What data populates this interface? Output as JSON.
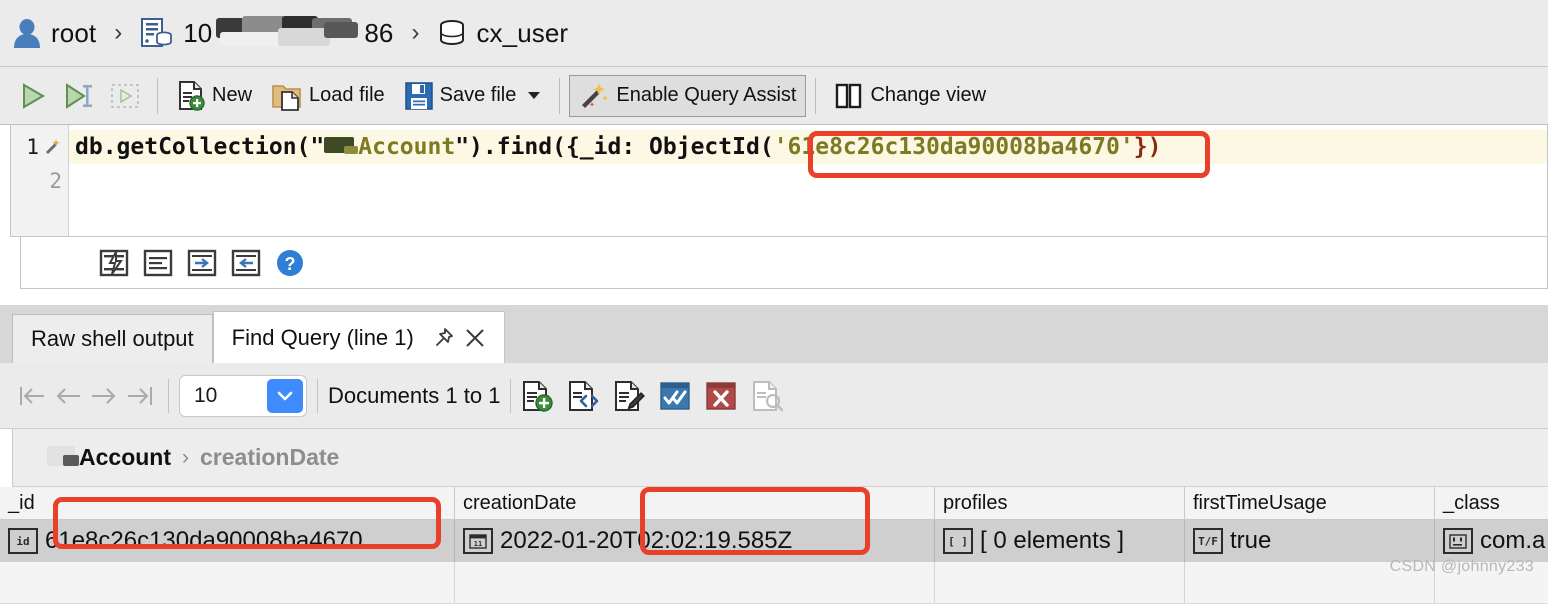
{
  "breadcrumb": {
    "user": "root",
    "server_visible_prefix": "10",
    "server_visible_suffix": "86",
    "server_redacted": true,
    "database": "cx_user",
    "separator": "›",
    "icons": [
      "user-icon",
      "server-icon",
      "database-icon"
    ]
  },
  "toolbar": {
    "run_label": "",
    "run_selection_label": "",
    "stop_label": "",
    "new_label": "New",
    "load_file_label": "Load file",
    "save_file_label": "Save file",
    "query_assist_label": "Enable Query Assist",
    "query_assist_pressed": true,
    "change_view_label": "Change view",
    "icons": [
      "run-icon",
      "run-selection-icon",
      "stop-icon",
      "new-file-icon",
      "load-file-icon",
      "save-file-icon",
      "magic-wand-icon",
      "change-view-icon"
    ]
  },
  "editor": {
    "line_numbers": [
      "1",
      "2"
    ],
    "active_line": 1,
    "code": {
      "prefix": "db.getCollection(\"",
      "collection_redacted": true,
      "collection_name": "Account",
      "mid": "\").find({_id: ObjectId(",
      "object_id": "'61e8c26c130da90008ba4670'",
      "suffix": "})"
    },
    "tool_icons": [
      "format-code-icon",
      "format-lines-icon",
      "indent-right-icon",
      "indent-left-icon",
      "help-icon"
    ]
  },
  "result_tabs": [
    {
      "label": "Raw shell output",
      "active": false,
      "pinned": false
    },
    {
      "label": "Find Query (line 1)",
      "active": true,
      "pinned": true
    }
  ],
  "tab_icons": {
    "pin": "pin-icon",
    "close": "close-icon"
  },
  "pager": {
    "page_size": "10",
    "documents_label": "Documents 1 to 1",
    "nav_icons": [
      "first-page-icon",
      "previous-page-icon",
      "next-page-icon",
      "last-page-icon"
    ],
    "nav_disabled": true,
    "action_icons": [
      "add-document-icon",
      "view-json-icon",
      "edit-document-icon",
      "confirm-icon",
      "cancel-icon",
      "inspect-document-icon"
    ]
  },
  "field_breadcrumb": {
    "collection_redacted": true,
    "collection": "Account",
    "separator": "›",
    "field": "creationDate"
  },
  "table": {
    "columns": [
      "_id",
      "creationDate",
      "profiles",
      "firstTimeUsage",
      "_class"
    ],
    "rows": [
      {
        "_id": {
          "value": "61e8c26c130da90008ba4670",
          "type_icon": "id"
        },
        "creationDate": {
          "value": "2022-01-20T02:02:19.585Z",
          "type_icon": "date"
        },
        "profiles": {
          "value": "[ 0 elements ]",
          "type_icon": "array"
        },
        "firstTimeUsage": {
          "value": "true",
          "type_icon": "bool"
        },
        "_class": {
          "value": "com.a",
          "type_icon": "string"
        }
      }
    ]
  },
  "annotations": {
    "color": "#e8402a",
    "boxes": [
      "objectid-in-query",
      "id-cell-value",
      "creationdate-time-portion"
    ]
  },
  "watermark": "CSDN @johnny233"
}
